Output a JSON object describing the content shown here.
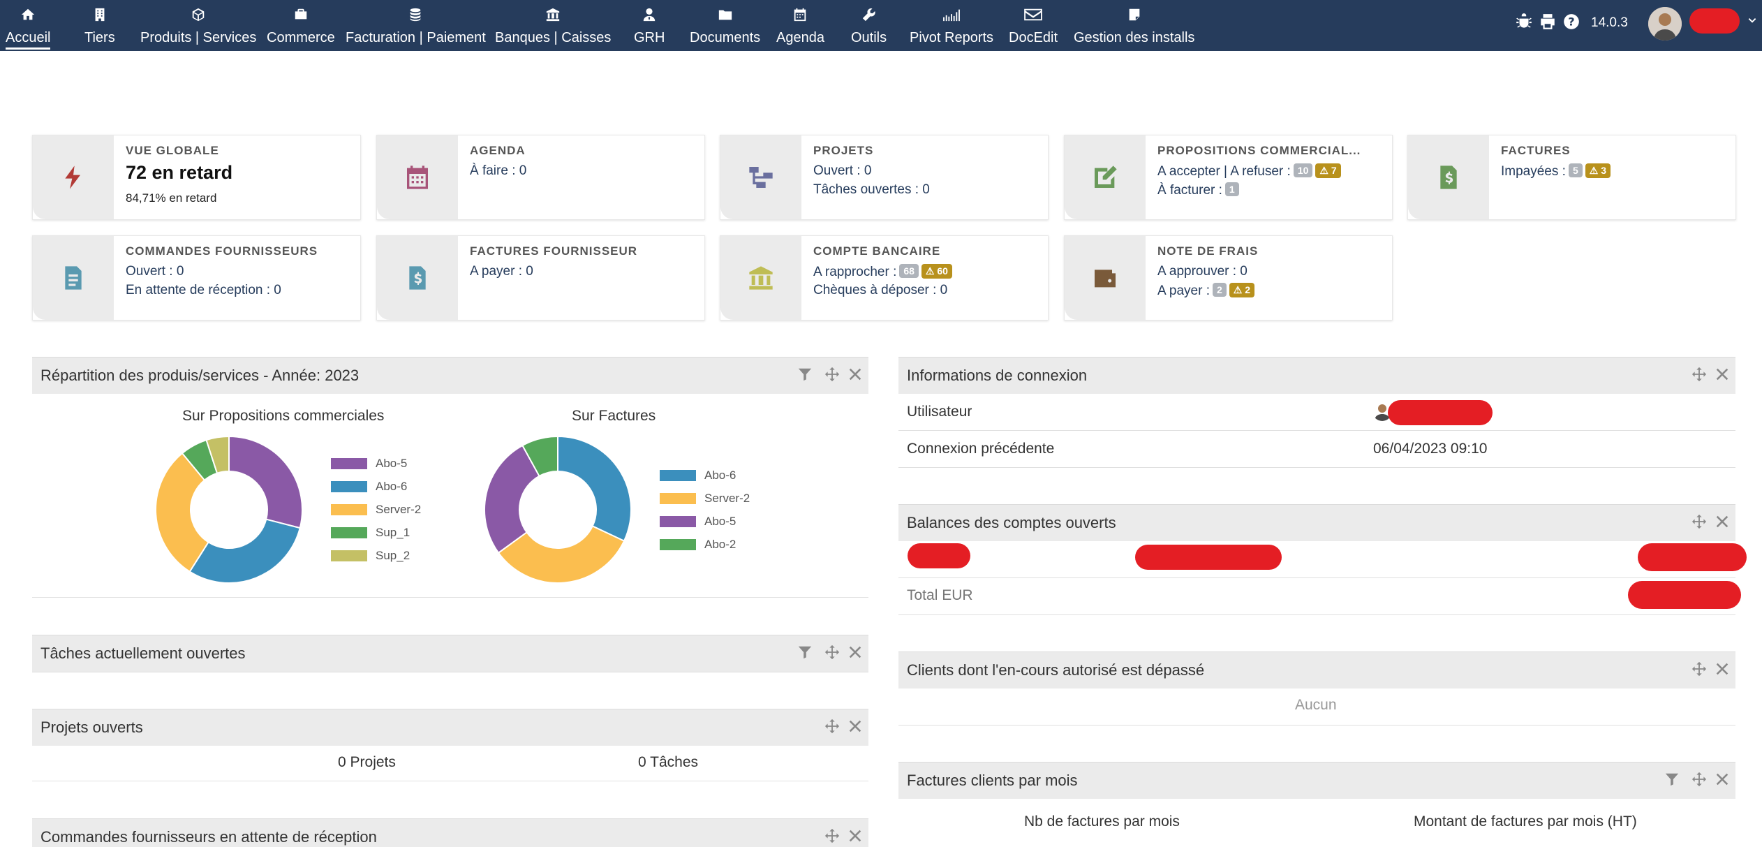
{
  "nav": {
    "items": [
      {
        "label": "Accueil",
        "icon": "home-icon"
      },
      {
        "label": "Tiers",
        "icon": "building-icon"
      },
      {
        "label": "Produits | Services",
        "icon": "cube-icon"
      },
      {
        "label": "Commerce",
        "icon": "briefcase-icon"
      },
      {
        "label": "Facturation | Paiement",
        "icon": "coins-icon"
      },
      {
        "label": "Banques | Caisses",
        "icon": "bank-icon"
      },
      {
        "label": "GRH",
        "icon": "user-tie-icon"
      },
      {
        "label": "Documents",
        "icon": "folder-icon"
      },
      {
        "label": "Agenda",
        "icon": "calendar-icon"
      },
      {
        "label": "Outils",
        "icon": "wrench-icon"
      },
      {
        "label": "Pivot Reports",
        "icon": "chart-icon"
      },
      {
        "label": "DocEdit",
        "icon": "envelope-icon"
      },
      {
        "label": "Gestion des installs",
        "icon": "note-icon"
      }
    ],
    "version": "14.0.3"
  },
  "boxes": {
    "vue_globale": {
      "title": "VUE GLOBALE",
      "big": "72 en retard",
      "small": "84,71% en retard"
    },
    "agenda": {
      "title": "AGENDA",
      "line1": "À faire : 0"
    },
    "projets": {
      "title": "PROJETS",
      "line1": "Ouvert : 0",
      "line2": "Tâches ouvertes : 0"
    },
    "propositions": {
      "title": "PROPOSITIONS COMMERCIAL...",
      "line1": "A accepter | A refuser :",
      "badge1": "10",
      "warn1": "7",
      "line2": "À facturer :",
      "badge2": "1"
    },
    "factures": {
      "title": "FACTURES",
      "line1": "Impayées :",
      "badge1": "5",
      "warn1": "3"
    },
    "commandes_fournisseurs": {
      "title": "COMMANDES FOURNISSEURS",
      "line1": "Ouvert : 0",
      "line2": "En attente de réception : 0"
    },
    "factures_fournisseur": {
      "title": "FACTURES FOURNISSEUR",
      "line1": "A payer : 0"
    },
    "compte_bancaire": {
      "title": "COMPTE BANCAIRE",
      "line1": "A rapprocher :",
      "badge1": "68",
      "warn1": "60",
      "line2": "Chèques à déposer : 0"
    },
    "note_de_frais": {
      "title": "NOTE DE FRAIS",
      "line1": "A approuver : 0",
      "line2": "A payer :",
      "badge2": "2",
      "warn2": "2"
    }
  },
  "panels": {
    "repartition": {
      "title": "Répartition des produis/services - Année: 2023",
      "chart1_title": "Sur Propositions commerciales",
      "chart2_title": "Sur Factures"
    },
    "taches": {
      "title": "Tâches actuellement ouvertes"
    },
    "projets_ouverts": {
      "title": "Projets ouverts",
      "col1": "0 Projets",
      "col2": "0 Tâches"
    },
    "commandes_attente": {
      "title": "Commandes fournisseurs en attente de réception"
    },
    "connexion": {
      "title": "Informations de connexion",
      "user_label": "Utilisateur",
      "prev_label": "Connexion précédente",
      "prev_value": "06/04/2023 09:10"
    },
    "balances": {
      "title": "Balances des comptes ouverts",
      "total_label": "Total EUR"
    },
    "clients_depasse": {
      "title": "Clients dont l'en-cours autorisé est dépassé",
      "empty": "Aucun"
    },
    "factures_mois": {
      "title": "Factures clients par mois",
      "col1": "Nb de factures par mois",
      "col2": "Montant de factures par mois (HT)"
    }
  },
  "colors": {
    "topbar": "#263c5c",
    "purple": "#8a59a6",
    "blue": "#3b8fbd",
    "orange": "#fbbe4f",
    "green": "#55a85a",
    "olive": "#c4c065",
    "warn": "#b8911c"
  },
  "chart_data": [
    {
      "type": "pie",
      "title": "Sur Propositions commerciales",
      "categories": [
        "Abo-5",
        "Abo-6",
        "Server-2",
        "Sup_1",
        "Sup_2"
      ],
      "values": [
        29,
        30,
        30,
        6,
        5
      ]
    },
    {
      "type": "pie",
      "title": "Sur Factures",
      "categories": [
        "Abo-6",
        "Server-2",
        "Abo-5",
        "Abo-2"
      ],
      "values": [
        32,
        33,
        27,
        8
      ]
    }
  ]
}
